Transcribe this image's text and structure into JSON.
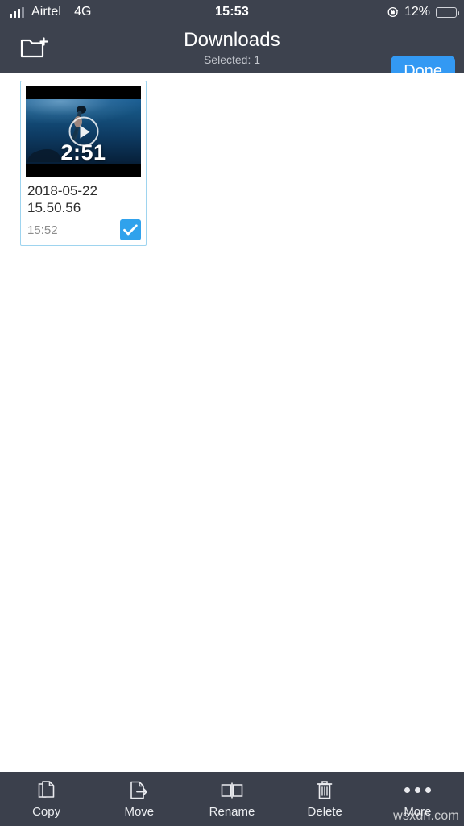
{
  "status_bar": {
    "carrier": "Airtel",
    "network": "4G",
    "time": "15:53",
    "battery_percent": "12%",
    "battery_level": 12,
    "rotation_lock_icon": "rotation-lock-icon",
    "signal_icon": "signal-bars-icon"
  },
  "nav_bar": {
    "new_folder_icon": "new-folder-icon",
    "title": "Downloads",
    "subtitle": "Selected: 1",
    "done_label": "Done"
  },
  "files": [
    {
      "name": "2018-05-22 15.50.56",
      "time": "15:52",
      "duration": "2:51",
      "selected": true,
      "type": "video",
      "play_icon": "play-icon",
      "check_icon": "checkmark-icon"
    }
  ],
  "toolbar": {
    "items": [
      {
        "label": "Copy",
        "icon": "copy-icon"
      },
      {
        "label": "Move",
        "icon": "move-icon"
      },
      {
        "label": "Rename",
        "icon": "rename-icon"
      },
      {
        "label": "Delete",
        "icon": "trash-icon"
      },
      {
        "label": "More",
        "icon": "more-dots-icon"
      }
    ]
  },
  "watermark": "wsxdn.com",
  "colors": {
    "chrome": "#3d424e",
    "toolbar": "#3b404c",
    "accent": "#3399f3",
    "check": "#30a2ec",
    "selection_border": "#9ed4ef",
    "battery_low": "#f0453a"
  }
}
